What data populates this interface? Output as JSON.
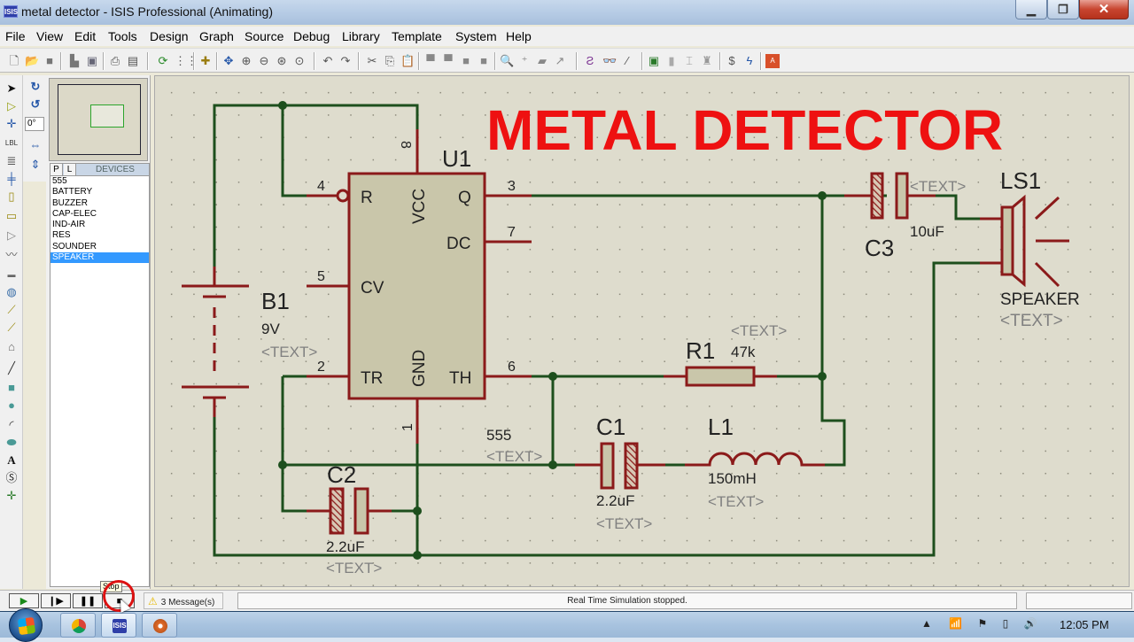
{
  "window": {
    "app_icon": "ISIS",
    "title": "metal detector - ISIS Professional (Animating)",
    "controls": {
      "minimize": "minimize-icon",
      "maximize": "restore-icon",
      "close": "close-icon"
    }
  },
  "menu": [
    "File",
    "View",
    "Edit",
    "Tools",
    "Design",
    "Graph",
    "Source",
    "Debug",
    "Library",
    "Template",
    "System",
    "Help"
  ],
  "toolbar": {
    "groups": [
      [
        "new-file-icon",
        "open-file-icon",
        "save-icon"
      ],
      [
        "import-icon",
        "export-icon"
      ],
      [
        "print-icon",
        "print-area-icon"
      ],
      [
        "refresh-icon",
        "grid-icon"
      ],
      [
        "origin-icon"
      ],
      [
        "pan-icon",
        "zoom-in-icon",
        "zoom-out-icon",
        "zoom-all-icon",
        "zoom-area-icon"
      ],
      [
        "undo-icon",
        "redo-icon"
      ],
      [
        "cut-icon",
        "copy-icon",
        "paste-icon"
      ],
      [
        "block-copy-icon",
        "block-move-icon",
        "block-rotate-icon",
        "block-delete-icon"
      ],
      [
        "pick-device-icon",
        "make-device-icon",
        "packaging-tool-icon",
        "decompose-icon"
      ],
      [
        "wire-autorouter-icon",
        "search-tag-icon",
        "property-assignment-tool-icon"
      ],
      [
        "new-sheet-icon",
        "remove-sheet-icon",
        "exit-to-parent-icon",
        "zoom-to-child-icon"
      ],
      [
        "bill-of-materials-icon",
        "electrical-rule-check-icon"
      ],
      [
        "netlist-to-ares-icon"
      ]
    ]
  },
  "left_tools": {
    "mode_icons": [
      "selection-mode-icon",
      "component-mode-icon",
      "junction-dot-icon",
      "wire-label-icon",
      "text-script-icon",
      "buses-icon",
      "subcircuit-icon",
      "terminals-icon",
      "device-pins-icon",
      "graph-icon",
      "tape-recorder-icon",
      "generator-icon",
      "voltage-probe-icon",
      "current-probe-icon",
      "virtual-instruments-icon",
      "line-icon",
      "box-icon",
      "circle-icon",
      "arc-icon",
      "closed-path-icon",
      "text-icon",
      "symbol-icon",
      "marker-icon"
    ],
    "orientation_icons": [
      "rotate-clockwise-icon",
      "rotate-anticlockwise-icon",
      "mirror-x-icon",
      "mirror-y-icon"
    ],
    "rotation_value": "0°"
  },
  "device_panel": {
    "tab_p": "P",
    "tab_l": "L",
    "header": "DEVICES",
    "items": [
      "555",
      "BATTERY",
      "BUZZER",
      "CAP-ELEC",
      "IND-AIR",
      "RES",
      "SOUNDER",
      "SPEAKER"
    ],
    "selected": "SPEAKER"
  },
  "schematic": {
    "title": "METAL DETECTOR",
    "colors": {
      "wire": "#1d4f1d",
      "component": "#8b1a1a",
      "body": "#c9c6aa",
      "title": "#ee1111",
      "placeholder": "#808080"
    },
    "u1": {
      "ref": "U1",
      "value": "555",
      "text": "<TEXT>",
      "pins": {
        "r": "R",
        "vcc": "VCC",
        "q": "Q",
        "dc": "DC",
        "cv": "CV",
        "tr": "TR",
        "gnd": "GND",
        "th": "TH"
      },
      "pin_numbers": {
        "r": "4",
        "vcc": "8",
        "q": "3",
        "dc": "7",
        "cv": "5",
        "tr": "2",
        "gnd": "1",
        "th": "6"
      }
    },
    "b1": {
      "ref": "B1",
      "value": "9V",
      "text": "<TEXT>"
    },
    "c1": {
      "ref": "C1",
      "value": "2.2uF",
      "text": "<TEXT>"
    },
    "c2": {
      "ref": "C2",
      "value": "2.2uF",
      "text": "<TEXT>"
    },
    "c3": {
      "ref": "C3",
      "value": "10uF",
      "text": "<TEXT>"
    },
    "r1": {
      "ref": "R1",
      "value": "47k",
      "text": "<TEXT>"
    },
    "l1": {
      "ref": "L1",
      "value": "150mH",
      "text": "<TEXT>"
    },
    "ls1": {
      "ref": "LS1",
      "value": "SPEAKER",
      "text": "<TEXT>"
    }
  },
  "simulation": {
    "buttons": [
      "play-icon",
      "step-icon",
      "pause-icon",
      "stop-icon"
    ],
    "tooltip": "Stop",
    "messages": "3 Message(s)",
    "status": "Real Time Simulation stopped."
  },
  "taskbar": {
    "start": "windows-start-icon",
    "apps": [
      "chrome-icon",
      "isis-icon",
      "paint-icon"
    ],
    "tray": [
      "show-hidden-icons",
      "signal-icon",
      "action-center-flag-icon",
      "battery-icon",
      "volume-icon"
    ],
    "clock": "12:05 PM"
  }
}
